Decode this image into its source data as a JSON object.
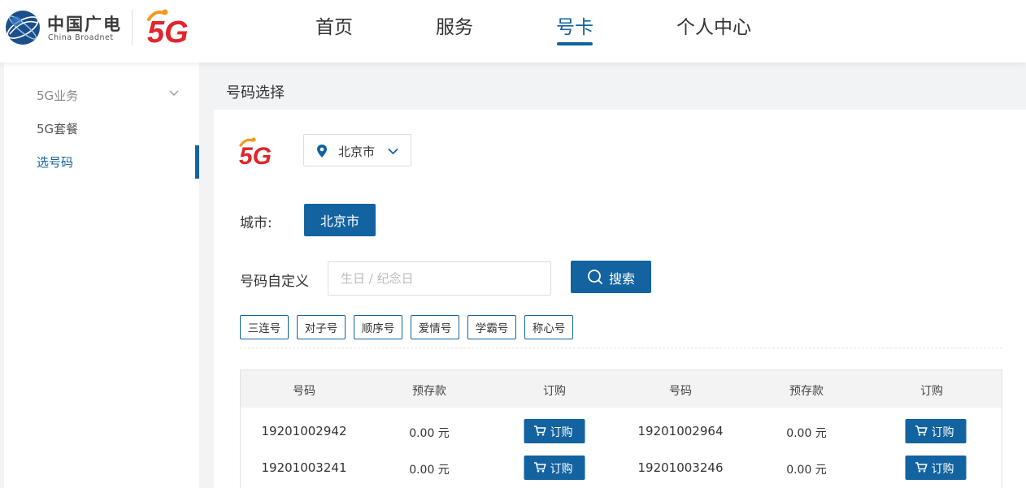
{
  "brand": {
    "name_cn": "中国广电",
    "name_en": "China Broadnet",
    "logo_5g": "5G"
  },
  "nav": {
    "items": [
      {
        "label": "首页",
        "active": false
      },
      {
        "label": "服务",
        "active": false
      },
      {
        "label": "号卡",
        "active": true
      },
      {
        "label": "个人中心",
        "active": false
      }
    ]
  },
  "sidebar": {
    "items": [
      {
        "label": "5G业务",
        "state": "muted",
        "expandable": true
      },
      {
        "label": "5G套餐",
        "state": "normal"
      },
      {
        "label": "选号码",
        "state": "active"
      }
    ]
  },
  "main": {
    "page_title": "号码选择",
    "location_select": "北京市",
    "city_label": "城市:",
    "city_button": "北京市",
    "custom_label": "号码自定义",
    "search_placeholder": "生日 / 纪念日",
    "search_value": "",
    "search_button": "搜索",
    "tags": [
      "三连号",
      "对子号",
      "顺序号",
      "爱情号",
      "学霸号",
      "称心号"
    ]
  },
  "table": {
    "headers": [
      "号码",
      "预存款",
      "订购",
      "号码",
      "预存款",
      "订购"
    ],
    "rows": [
      [
        {
          "number": "19201002942",
          "deposit": "0.00 元",
          "order": "订购"
        },
        {
          "number": "19201002964",
          "deposit": "0.00 元",
          "order": "订购"
        }
      ],
      [
        {
          "number": "19201003241",
          "deposit": "0.00 元",
          "order": "订购"
        },
        {
          "number": "19201003246",
          "deposit": "0.00 元",
          "order": "订购"
        }
      ]
    ]
  },
  "colors": {
    "accent": "#1263a0",
    "brand_5g_red": "#e0262c",
    "brand_5g_orange": "#f39a1e"
  },
  "icons": [
    "location-pin-icon",
    "chevron-down-icon",
    "search-icon",
    "cart-icon"
  ]
}
